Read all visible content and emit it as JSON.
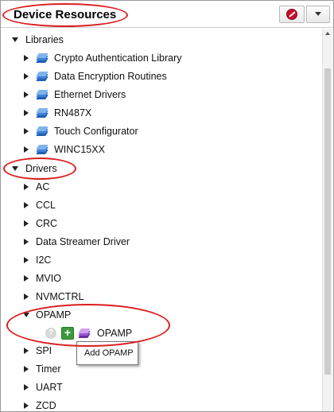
{
  "header": {
    "title": "Device Resources"
  },
  "icons": {
    "stop": "stop-icon",
    "dropdown": "chevron-down-icon",
    "library": "layers-icon",
    "component": "layers-icon",
    "help": "help-icon",
    "add": "plus-icon"
  },
  "colors": {
    "highlight": "#d91e1e",
    "library_icon": "#3f80d6",
    "component_icon": "#9a59cf",
    "add_button": "#3c9a3c"
  },
  "tree": {
    "libraries": {
      "label": "Libraries",
      "items": [
        {
          "label": "Crypto Authentication Library"
        },
        {
          "label": "Data Encryption Routines"
        },
        {
          "label": "Ethernet Drivers"
        },
        {
          "label": "RN487X"
        },
        {
          "label": "Touch Configurator"
        },
        {
          "label": "WINC15XX"
        }
      ]
    },
    "drivers": {
      "label": "Drivers",
      "items": [
        {
          "label": "AC"
        },
        {
          "label": "CCL"
        },
        {
          "label": "CRC"
        },
        {
          "label": "Data Streamer Driver"
        },
        {
          "label": "I2C"
        },
        {
          "label": "MVIO"
        },
        {
          "label": "NVMCTRL"
        },
        {
          "label": "OPAMP",
          "expanded": true,
          "children": [
            {
              "label": "OPAMP"
            }
          ]
        },
        {
          "label": "SPI"
        },
        {
          "label": "Timer"
        },
        {
          "label": "UART"
        },
        {
          "label": "ZCD"
        }
      ]
    }
  },
  "tooltip": {
    "text": "Add OPAMP"
  }
}
